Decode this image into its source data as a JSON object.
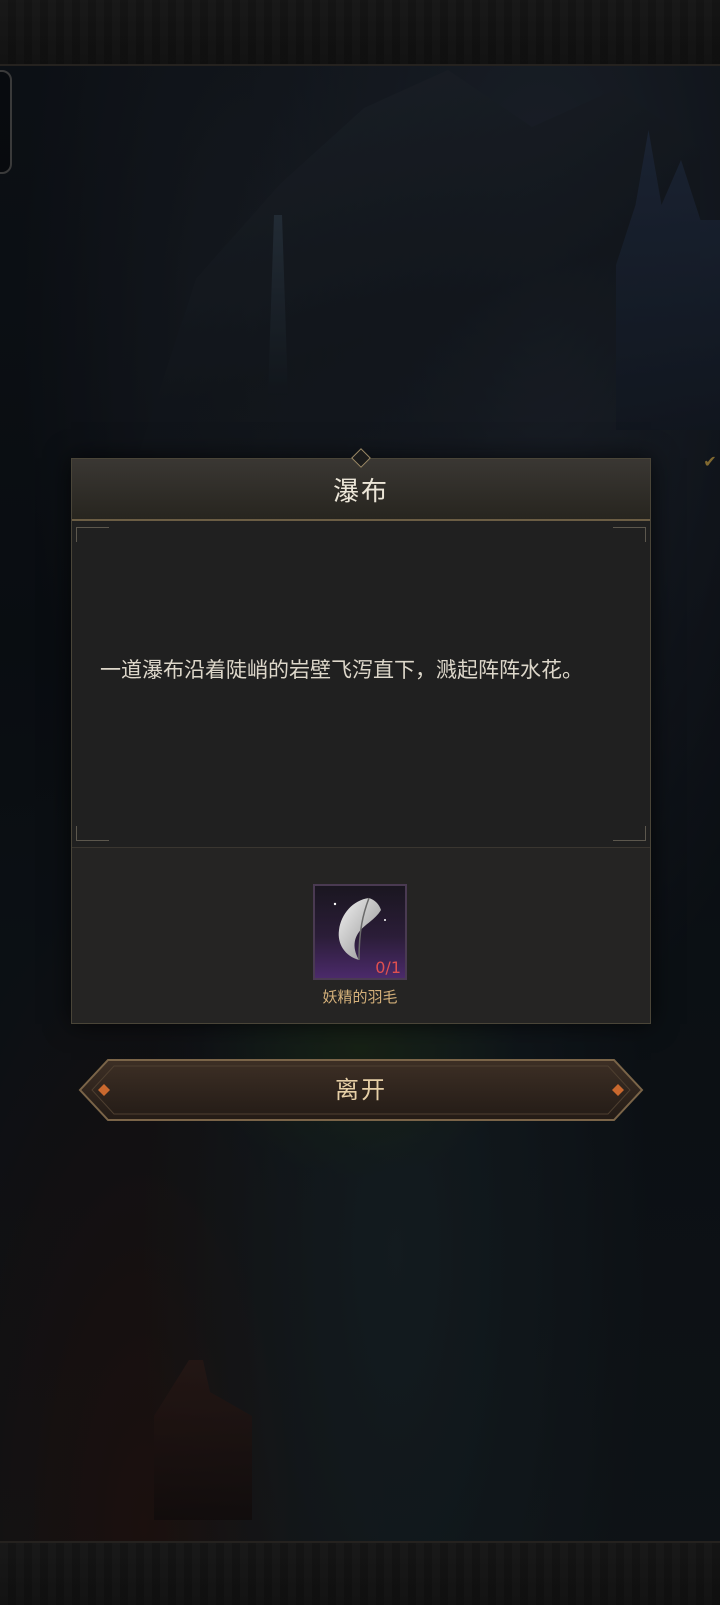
{
  "dialog": {
    "title": "瀑布",
    "description": "一道瀑布沿着陡峭的岩壁飞泻直下，溅起阵阵水花。",
    "reward": {
      "item_icon": "feather-icon",
      "item_name": "妖精的羽毛",
      "count": "0/1"
    }
  },
  "actions": {
    "leave_label": "离开"
  },
  "colors": {
    "accent_gold": "#d4b07a",
    "count_red": "#e05050",
    "rare_purple": "#4b2a6a"
  }
}
